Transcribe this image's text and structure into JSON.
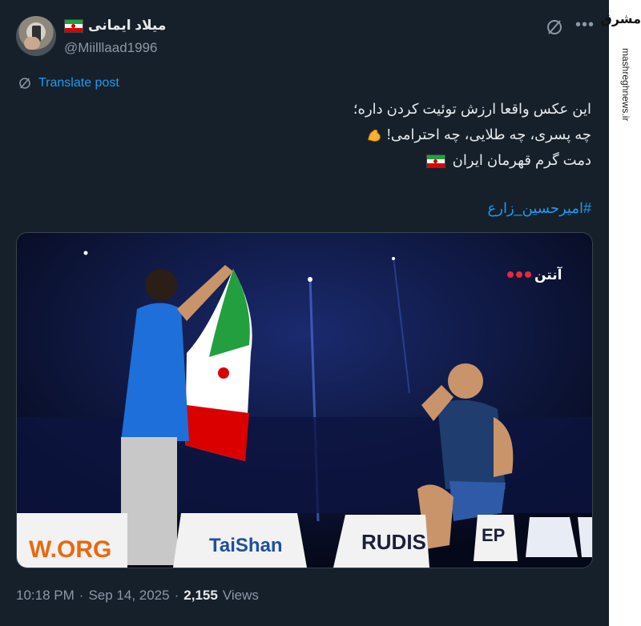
{
  "user": {
    "display_name": "میلاد ایمانی",
    "handle": "@Miilllaad1996"
  },
  "translate_label": "Translate post",
  "post": {
    "line1": "این عکس واقعا ارزش توئیت کردن داره؛",
    "line2": "چه پسری، چه طلایی، چه احترامی!",
    "line3": "دمت گرم قهرمان ایران",
    "hashtag": "#امیرحسین_زارع"
  },
  "media": {
    "channel_logo": "آنتن",
    "sponsor_left": "W.ORG",
    "sponsor_mid": "TaiShan",
    "sponsor_right": "RUDIS",
    "sponsor_right_tail": "EP"
  },
  "meta": {
    "time": "10:18 PM",
    "date": "Sep 14, 2025",
    "views_count": "2,155",
    "views_label": "Views",
    "separator": "·"
  },
  "watermark": {
    "logo": "مشرق",
    "site": "mashreghnews.ir"
  },
  "colors": {
    "background": "#15202b",
    "link": "#1d9bf0",
    "muted": "#8b98a5",
    "text": "#e7e9ea"
  }
}
